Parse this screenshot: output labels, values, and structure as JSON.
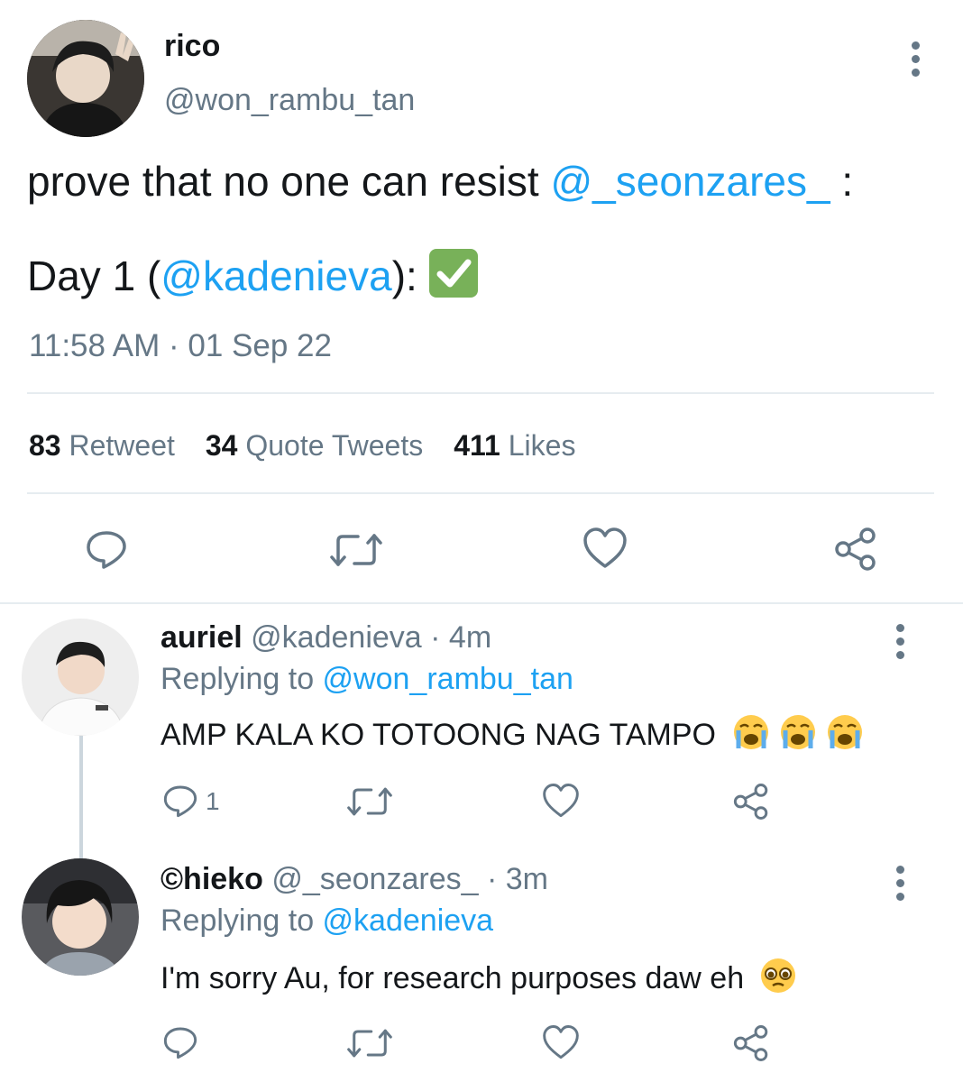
{
  "main_tweet": {
    "display_name": "rico",
    "handle": "@won_rambu_tan",
    "text_prefix": "prove that no one can resist ",
    "mention_1": "@_seonzares_",
    "text_suffix": " :",
    "line2_prefix": "Day 1 (",
    "mention_2": "@kadenieva",
    "line2_suffix": "): ",
    "check_emoji": "✅",
    "timestamp": "11:58 AM · 01 Sep 22",
    "stats": {
      "retweets_count": "83",
      "retweets_label": "Retweet",
      "quotes_count": "34",
      "quotes_label": "Quote Tweets",
      "likes_count": "411",
      "likes_label": "Likes"
    }
  },
  "replies": [
    {
      "display_name": "auriel",
      "handle": "@kadenieva",
      "time": "· 4m",
      "replying_label": "Replying to ",
      "replying_to": "@won_rambu_tan",
      "text": "AMP KALA KO TOTOONG NAG TAMPO",
      "emojis": "😭😭😭",
      "reply_count": "1"
    },
    {
      "display_name": "©hieko",
      "handle": "@_seonzares_",
      "time": "· 3m",
      "replying_label": "Replying to ",
      "replying_to": "@kadenieva",
      "text": "I'm sorry Au, for research purposes daw eh",
      "emojis": "🥺"
    }
  ],
  "icons": {
    "reply": "reply-icon",
    "retweet": "retweet-icon",
    "like": "heart-icon",
    "share": "share-icon",
    "more": "more-vertical-icon"
  },
  "colors": {
    "link": "#1da1f2",
    "secondary_text": "#657786",
    "divider": "#e6ecf0"
  }
}
